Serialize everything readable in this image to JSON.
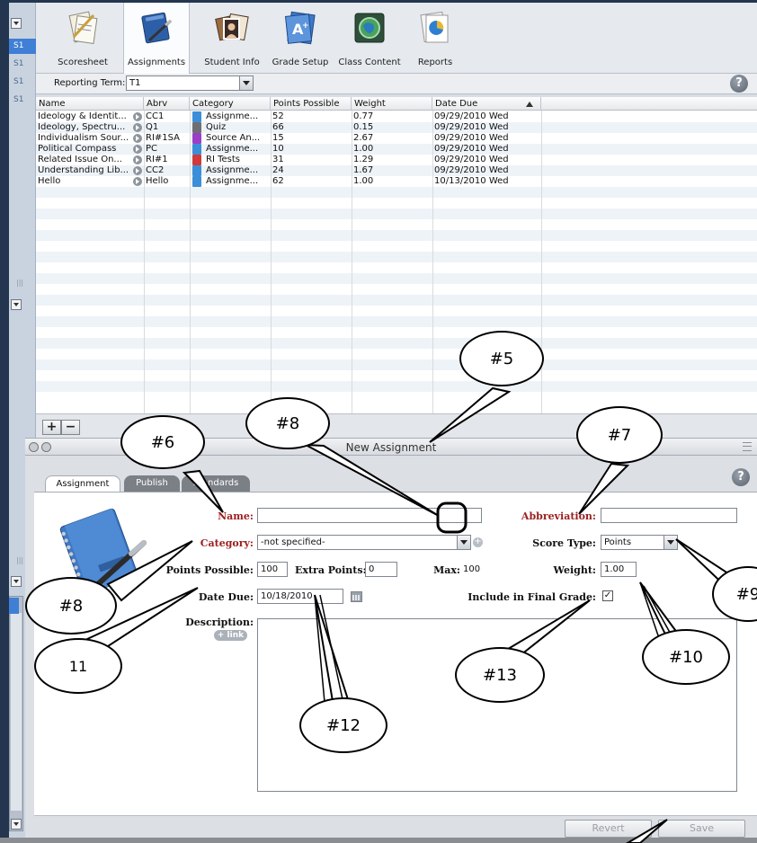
{
  "side": {
    "items": [
      "S1",
      "S1",
      "S1",
      "S1"
    ]
  },
  "toolbar": {
    "tabs": [
      {
        "label": "Scoresheet",
        "icon": "scoresheet-icon"
      },
      {
        "label": "Assignments",
        "icon": "assignments-icon"
      },
      {
        "label": "Student Info",
        "icon": "student-info-icon"
      },
      {
        "label": "Grade Setup",
        "icon": "grade-setup-icon"
      },
      {
        "label": "Class Content",
        "icon": "class-content-icon"
      },
      {
        "label": "Reports",
        "icon": "reports-icon"
      }
    ]
  },
  "term": {
    "label": "Reporting Term:",
    "value": "T1"
  },
  "help_label": "?",
  "table": {
    "headers": [
      "Name",
      "Abrv",
      "Category",
      "Points Possible",
      "Weight",
      "Date Due"
    ],
    "rows": [
      {
        "name": "Ideology & Identit...",
        "abrv": "CC1",
        "category": "Assignme...",
        "points": "52",
        "weight": "0.77",
        "date": "09/29/2010 Wed",
        "cat_color": "#3b8fd8"
      },
      {
        "name": "Ideology, Spectru...",
        "abrv": "Q1",
        "category": "Quiz",
        "points": "66",
        "weight": "0.15",
        "date": "09/29/2010 Wed",
        "cat_color": "#6f6f73"
      },
      {
        "name": "Individualism Sour...",
        "abrv": "RI#1SA",
        "category": "Source An...",
        "points": "15",
        "weight": "2.67",
        "date": "09/29/2010 Wed",
        "cat_color": "#9c3fc7"
      },
      {
        "name": "Political Compass",
        "abrv": "PC",
        "category": "Assignme...",
        "points": "10",
        "weight": "1.00",
        "date": "09/29/2010 Wed",
        "cat_color": "#3b8fd8"
      },
      {
        "name": "Related Issue On...",
        "abrv": "RI#1",
        "category": "RI Tests",
        "points": "31",
        "weight": "1.29",
        "date": "09/29/2010 Wed",
        "cat_color": "#d03a3a"
      },
      {
        "name": "Understanding Lib...",
        "abrv": "CC2",
        "category": "Assignme...",
        "points": "24",
        "weight": "1.67",
        "date": "09/29/2010 Wed",
        "cat_color": "#3b8fd8"
      },
      {
        "name": "Hello",
        "abrv": "Hello",
        "category": "Assignme...",
        "points": "62",
        "weight": "1.00",
        "date": "10/13/2010 Wed",
        "cat_color": "#3b8fd8"
      }
    ],
    "add_label": "+",
    "remove_label": "−"
  },
  "dialog": {
    "title": "New Assignment",
    "tabs": [
      "Assignment",
      "Publish",
      "Standards"
    ],
    "fields": {
      "name_label": "Name:",
      "name_value": "",
      "abbrev_label": "Abbreviation:",
      "abbrev_value": "",
      "category_label": "Category:",
      "category_value": "-not specified-",
      "score_type_label": "Score Type:",
      "score_type_value": "Points",
      "points_label": "Points Possible:",
      "points_value": "100",
      "extra_label": "Extra Points:",
      "extra_value": "0",
      "max_label": "Max:",
      "max_value": "100",
      "weight_label": "Weight:",
      "weight_value": "1.00",
      "date_label": "Date Due:",
      "date_value": "10/18/2010",
      "final_label": "Include in Final Grade:",
      "final_checked": "✓",
      "desc_label": "Description:",
      "link_label": "+ link"
    },
    "revert_label": "Revert",
    "save_label": "Save"
  },
  "callouts": [
    "#5",
    "#6",
    "#7",
    "#8",
    "#8",
    "#9",
    "#10",
    "11",
    "#12",
    "#13"
  ]
}
